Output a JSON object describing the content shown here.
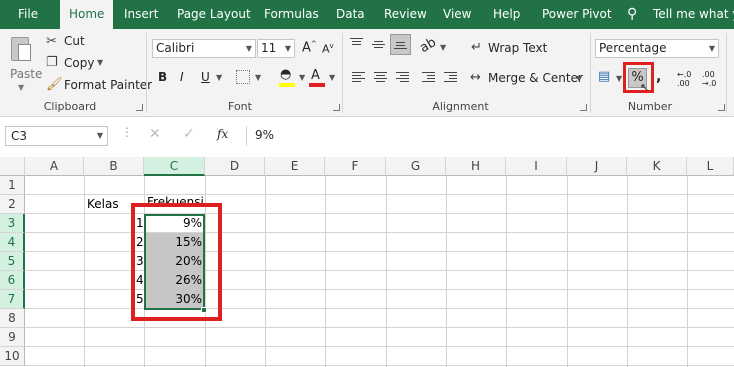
{
  "tabs": [
    {
      "label": "File"
    },
    {
      "label": "Home"
    },
    {
      "label": "Insert"
    },
    {
      "label": "Page Layout"
    },
    {
      "label": "Formulas"
    },
    {
      "label": "Data"
    },
    {
      "label": "Review"
    },
    {
      "label": "View"
    },
    {
      "label": "Help"
    },
    {
      "label": "Power Pivot"
    }
  ],
  "tell_me": "Tell me what you",
  "clipboard": {
    "paste": "Paste",
    "cut": "Cut",
    "copy": "Copy",
    "format_painter": "Format Painter",
    "group": "Clipboard"
  },
  "font": {
    "name": "Calibri",
    "size": "11",
    "bold": "B",
    "italic": "I",
    "underline": "U",
    "group": "Font"
  },
  "alignment": {
    "wrap_text": "Wrap Text",
    "merge_center": "Merge & Center",
    "group": "Alignment"
  },
  "number": {
    "format": "Percentage",
    "percent_symbol": "%",
    "comma": ",",
    "dec_inc": "←.0 .00",
    "dec_dec": ".00 →.0",
    "group": "Number"
  },
  "formula_bar": {
    "name_box": "C3",
    "content": "9%"
  },
  "columns": [
    "A",
    "B",
    "C",
    "D",
    "E",
    "F",
    "G",
    "H",
    "I",
    "J",
    "K",
    "L"
  ],
  "rows": [
    "1",
    "2",
    "3",
    "4",
    "5",
    "6",
    "7",
    "8",
    "9",
    "10"
  ],
  "cells": {
    "b2": "Kelas",
    "c2": "Frekuensi",
    "kelas": [
      "1",
      "2",
      "3",
      "4",
      "5"
    ],
    "frekuensi": [
      "9%",
      "15%",
      "20%",
      "26%",
      "30%"
    ]
  },
  "colors": {
    "brand": "#217346",
    "highlight": "#e02020",
    "selection": "#c6c6c6"
  }
}
